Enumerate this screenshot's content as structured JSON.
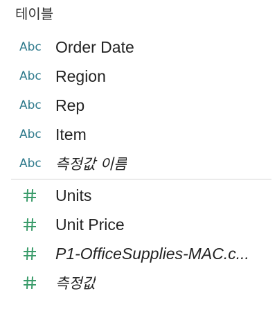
{
  "panel": {
    "title": "테이블"
  },
  "dimensions": [
    {
      "type_icon": "abc-string-icon",
      "type_label": "Abc",
      "label": "Order Date",
      "italic": false
    },
    {
      "type_icon": "abc-string-icon",
      "type_label": "Abc",
      "label": "Region",
      "italic": false
    },
    {
      "type_icon": "abc-string-icon",
      "type_label": "Abc",
      "label": "Rep",
      "italic": false
    },
    {
      "type_icon": "abc-string-icon",
      "type_label": "Abc",
      "label": "Item",
      "italic": false
    },
    {
      "type_icon": "abc-string-icon",
      "type_label": "Abc",
      "label": "측정값 이름",
      "italic": true
    }
  ],
  "measures": [
    {
      "type_icon": "hash-number-icon",
      "label": "Units",
      "italic": false
    },
    {
      "type_icon": "hash-number-icon",
      "label": "Unit Price",
      "italic": false
    },
    {
      "type_icon": "hash-number-icon",
      "label": "P1-OfficeSupplies-MAC.c...",
      "italic": true
    },
    {
      "type_icon": "hash-number-icon",
      "label": "측정값",
      "italic": true
    }
  ],
  "colors": {
    "abc_icon": "#2f7a8c",
    "hash_icon": "#3a9b6a",
    "divider": "#d4d4d4"
  }
}
